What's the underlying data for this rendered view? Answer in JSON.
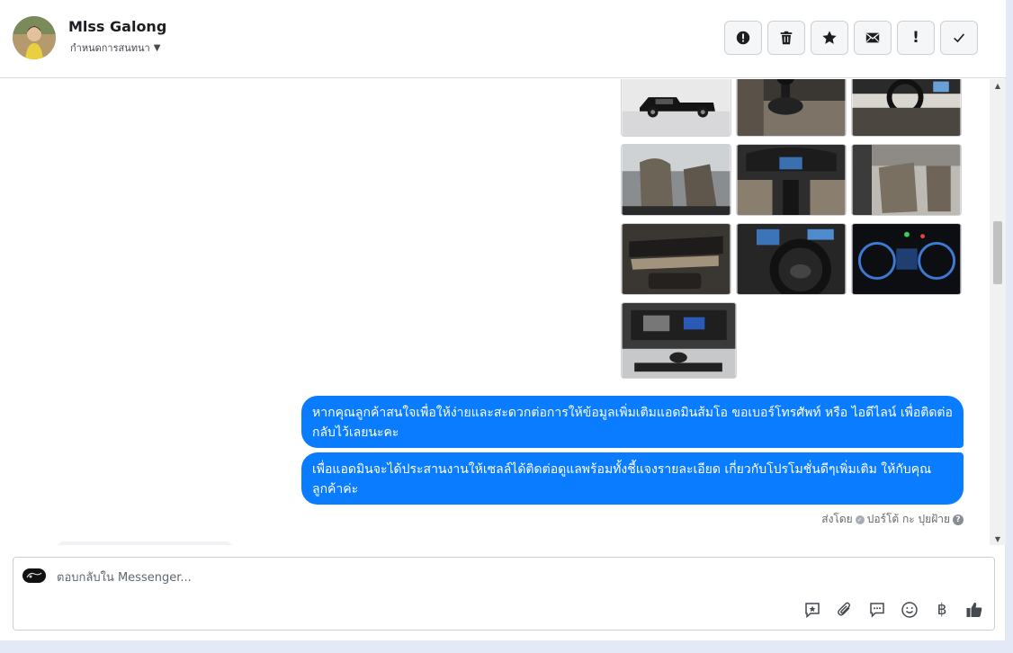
{
  "header": {
    "contact_name": "Mlss Galong",
    "assign_label": "กำหนดการสนทนา",
    "toolbar": [
      {
        "name": "report-spam-button",
        "icon": "alert-circle-icon"
      },
      {
        "name": "delete-button",
        "icon": "trash-icon"
      },
      {
        "name": "star-button",
        "icon": "star-icon"
      },
      {
        "name": "mark-unread-button",
        "icon": "envelope-icon"
      },
      {
        "name": "follow-up-button",
        "icon": "exclamation-icon",
        "glyph": "!"
      },
      {
        "name": "mark-done-button",
        "icon": "checkmark-icon",
        "glyph": "✓"
      }
    ]
  },
  "conversation": {
    "photos": [
      {
        "name": "photo-exterior-side",
        "icon": "truck-photo"
      },
      {
        "name": "photo-gear-shifter",
        "icon": "gearshift-photo"
      },
      {
        "name": "photo-dashboard-steering",
        "icon": "dashboard-photo"
      },
      {
        "name": "photo-front-seats",
        "icon": "seats-photo"
      },
      {
        "name": "photo-center-console",
        "icon": "console-photo"
      },
      {
        "name": "photo-interior-rear",
        "icon": "seats-photo"
      },
      {
        "name": "photo-door-panel",
        "icon": "door-photo"
      },
      {
        "name": "photo-steering-wheel",
        "icon": "steering-photo"
      },
      {
        "name": "photo-instrument-cluster",
        "icon": "gauges-photo"
      },
      {
        "name": "photo-engine-bay",
        "icon": "engine-photo"
      }
    ],
    "messages": [
      {
        "text": "หากคุณลูกค้าสนใจเพื่อให้ง่ายและสะดวกต่อการให้ข้อมูลเพิ่มเติมแอดมินส้มโอ ขอเบอร์โทรศัพท์ หรือ ไอดีไลน์ เพื่อติดต่อกลับไว้เลยนะคะ"
      },
      {
        "text": "เพื่อแอดมินจะได้ประสานงานให้เซลล์ได้ติดต่อดูแลพร้อมทั้งชี้แจงรายละเอียด เกี่ยวกับโปรโมชั่นดีๆเพิ่มเติม ให้กับคุณลูกค้าค่ะ"
      }
    ],
    "sent_by_label": "ส่งโดย",
    "sent_by_name": "ปอร์โต้ กะ ปุยฝ้าย",
    "help_glyph": "?"
  },
  "composer": {
    "placeholder": "ตอบกลับใน Messenger...",
    "tools": [
      {
        "name": "saved-reply-button",
        "icon": "chat-star-icon"
      },
      {
        "name": "attach-button",
        "icon": "paperclip-icon"
      },
      {
        "name": "quick-reply-button",
        "icon": "speech-bubble-icon"
      },
      {
        "name": "emoji-button",
        "icon": "smiley-icon"
      },
      {
        "name": "payment-button",
        "icon": "baht-icon",
        "glyph": "฿"
      },
      {
        "name": "like-button",
        "icon": "thumbs-up-icon"
      }
    ]
  },
  "colors": {
    "bubble": "#0a7cff",
    "background": "#e4e9f7"
  }
}
